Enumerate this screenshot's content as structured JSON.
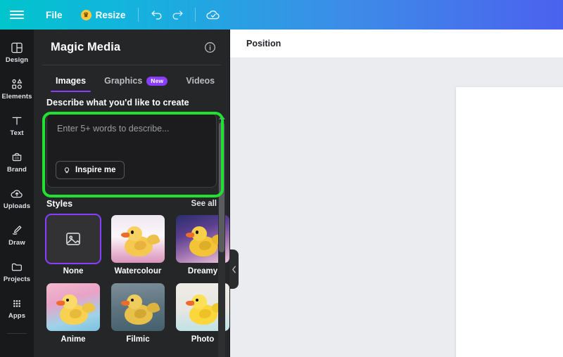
{
  "topbar": {
    "menu_icon": "hamburger-icon",
    "file_label": "File",
    "resize_label": "Resize",
    "resize_badge_icon": "crown-icon",
    "undo_icon": "undo-icon",
    "redo_icon": "redo-icon",
    "save_status_icon": "cloud-check-icon",
    "gradient_start": "#00c4cc",
    "gradient_end": "#4b61ee"
  },
  "rail": {
    "items": [
      {
        "label": "Design",
        "icon": "design-icon"
      },
      {
        "label": "Elements",
        "icon": "elements-icon"
      },
      {
        "label": "Text",
        "icon": "text-icon"
      },
      {
        "label": "Brand",
        "icon": "brand-icon"
      },
      {
        "label": "Uploads",
        "icon": "uploads-icon"
      },
      {
        "label": "Draw",
        "icon": "draw-icon"
      },
      {
        "label": "Projects",
        "icon": "projects-icon"
      },
      {
        "label": "Apps",
        "icon": "apps-icon"
      }
    ]
  },
  "panel": {
    "title": "Magic Media",
    "info_icon": "info-circle-icon",
    "tabs": [
      {
        "label": "Images",
        "active": true,
        "badge": ""
      },
      {
        "label": "Graphics",
        "active": false,
        "badge": "New"
      },
      {
        "label": "Videos",
        "active": false,
        "badge": ""
      }
    ],
    "describe_label": "Describe what you'd like to create",
    "prompt_placeholder": "Enter 5+ words to describe...",
    "prompt_value": "",
    "inspire_label": "Inspire me",
    "inspire_icon": "lightbulb-icon",
    "styles_label": "Styles",
    "see_all_label": "See all",
    "highlight_color": "#22e033",
    "accent_color": "#8b3dff",
    "styles": [
      {
        "name": "None",
        "selected": true,
        "icon": "image-placeholder-icon",
        "body": "",
        "head": "",
        "wing": "",
        "bg": ""
      },
      {
        "name": "Watercolour",
        "selected": false,
        "icon": "",
        "body": "#f5c94f",
        "head": "#f7d263",
        "wing": "#e8b33c",
        "bg": "linear-gradient(180deg,#efe6f0 0%,#fbf8fa 45%,#e9b8d2 78%,#d994bb 100%)"
      },
      {
        "name": "Dreamy",
        "selected": false,
        "icon": "",
        "body": "#f3c436",
        "head": "#f7d04b",
        "wing": "#dfae28",
        "bg": "linear-gradient(160deg,#2b2e6b 0%,#5b3f8f 35%,#9c6fae 60%,#f2c7da 100%)"
      },
      {
        "name": "Anime",
        "selected": false,
        "icon": "",
        "body": "#f7d14f",
        "head": "#fadb6a",
        "wing": "#e6bb3a",
        "bg": "linear-gradient(165deg,#f3b9cf 0%,#e9a2c6 35%,#9fd3e8 72%,#7bc0e0 100%)"
      },
      {
        "name": "Filmic",
        "selected": false,
        "icon": "",
        "body": "#e8c14a",
        "head": "#efcc5d",
        "wing": "#d2a833",
        "bg": "linear-gradient(175deg,#7d8f99 0%,#5c737f 50%,#44606d 100%)"
      },
      {
        "name": "Photo",
        "selected": false,
        "icon": "",
        "body": "#fcd73b",
        "head": "#fde055",
        "wing": "#eec226",
        "bg": "linear-gradient(180deg,#efece7 0%,#e8e6e2 55%,#bfe2e6 100%)"
      }
    ],
    "scrollbar_icon": "scroll-up-arrow-icon"
  },
  "collapse": {
    "icon": "chevron-left-icon"
  },
  "editor": {
    "position_label": "Position",
    "canvas_bg": "#ebecef",
    "page_bg": "#ffffff"
  }
}
